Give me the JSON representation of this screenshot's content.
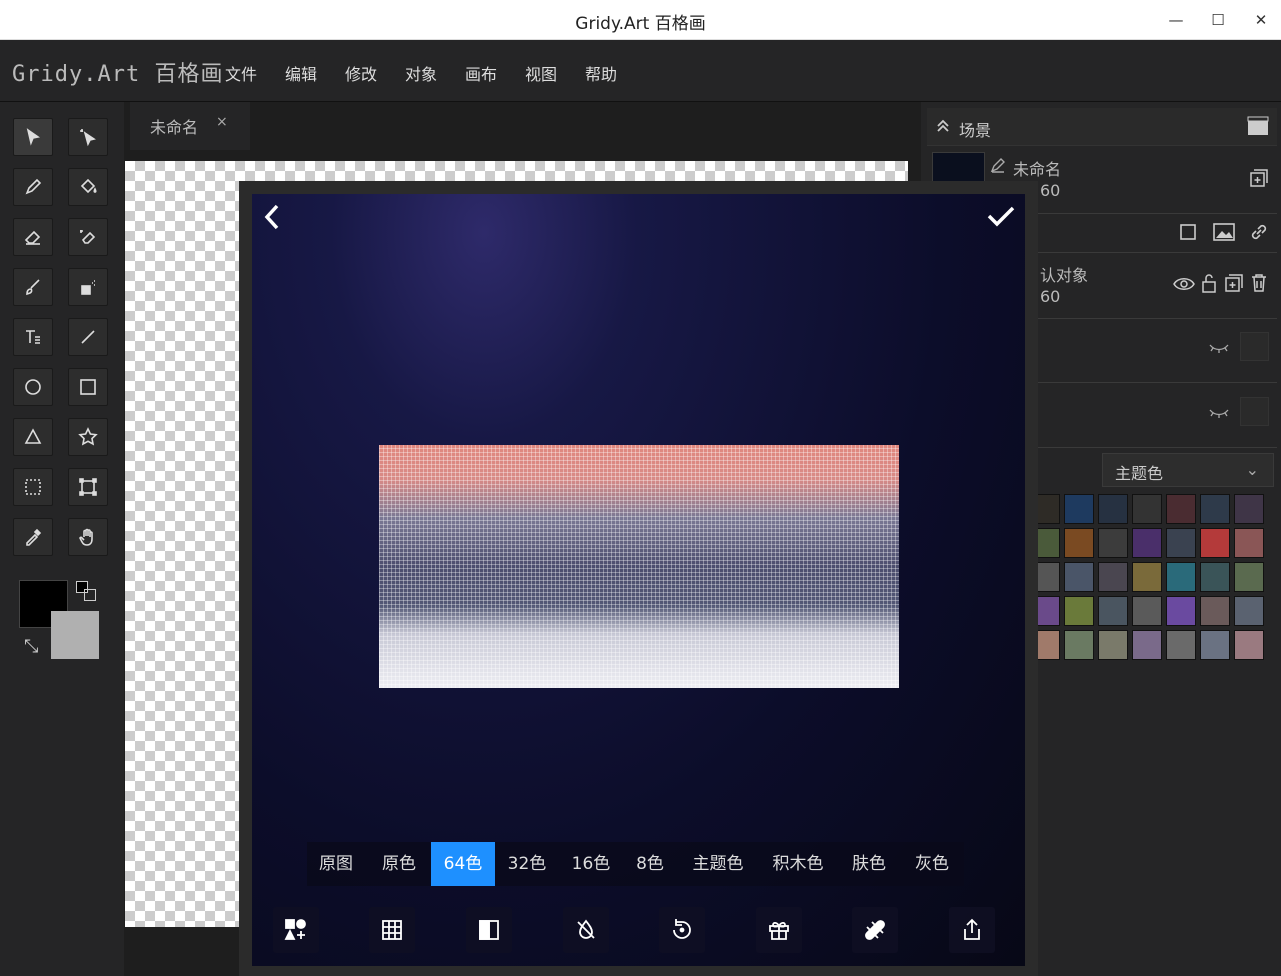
{
  "window": {
    "title": "Gridy.Art 百格画",
    "minimize": "—",
    "maximize": "☐",
    "close": "✕"
  },
  "app": {
    "logo": "Gridy.Art 百格画"
  },
  "menu": [
    "文件",
    "编辑",
    "修改",
    "对象",
    "画布",
    "视图",
    "帮助"
  ],
  "document_tab": {
    "label": "未命名",
    "close": "×"
  },
  "scene": {
    "header": "场景",
    "item_name": "未命名",
    "item_size": "60",
    "object_name": "认对象",
    "object_size": "60"
  },
  "palette": {
    "select_value": "主题色",
    "colors": [
      [
        "#2e2b26",
        "#1e3a5f",
        "#263141",
        "#333333",
        "#4a2c31",
        "#2e3a4a",
        "#3f3547"
      ],
      [
        "#4a5a3a",
        "#7a4a22",
        "#3c3c3c",
        "#4a2f6a",
        "#3a4250",
        "#b43a3a",
        "#8a5656"
      ],
      [
        "#555555",
        "#4a5568",
        "#4a4650",
        "#7a6a3a",
        "#2a6a7a",
        "#3a5458",
        "#5a6a4f"
      ],
      [
        "#6a4a8a",
        "#6a7a3a",
        "#4a5560",
        "#5a5a5a",
        "#6a4aa0",
        "#6a5a5a",
        "#5a6270"
      ],
      [
        "#a07a6a",
        "#6a7a62",
        "#7a7a6a",
        "#7a6a8a",
        "#6a6a6a",
        "#6a7282",
        "#9a7a80"
      ]
    ]
  },
  "color_modes": [
    "原图",
    "原色",
    "64色",
    "32色",
    "16色",
    "8色",
    "主题色",
    "积木色",
    "肤色",
    "灰色"
  ],
  "color_mode_selected": "64色",
  "colors": {
    "accent": "#1e90ff",
    "primary_color": "#000000",
    "secondary_color": "#b0b0b0"
  }
}
